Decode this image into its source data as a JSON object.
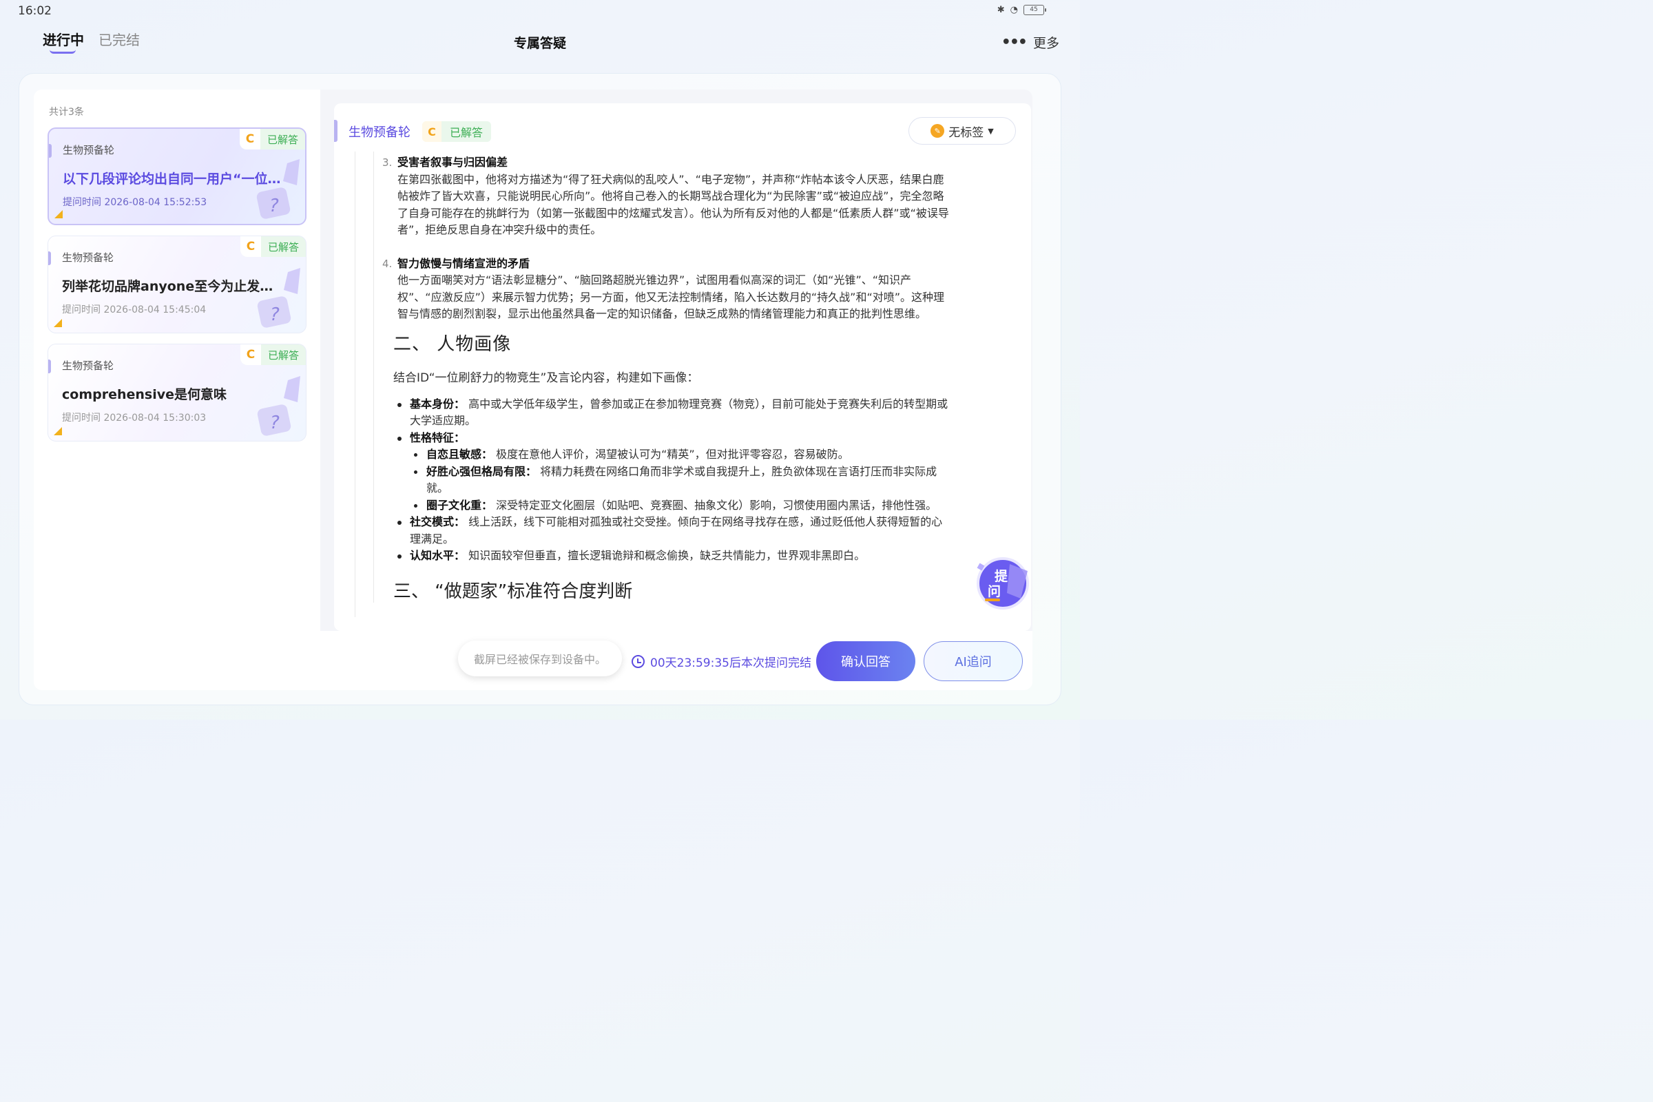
{
  "status_bar": {
    "time": "16:02",
    "battery": "45"
  },
  "nav": {
    "tabs": [
      {
        "label": "进行中"
      },
      {
        "label": "已完结"
      }
    ],
    "title": "专属答疑",
    "more_label": "更多"
  },
  "list": {
    "count": "共计3条",
    "cards": [
      {
        "subject": "生物预备轮",
        "badge_letter": "C",
        "status": "已解答",
        "question": "以下几段评论均出自同一用户“一位…",
        "time": "提问时间 2026-08-04 15:52:53"
      },
      {
        "subject": "生物预备轮",
        "badge_letter": "C",
        "status": "已解答",
        "question": "列举花切品牌anyone至今为止发售…",
        "time": "提问时间 2026-08-04 15:45:04"
      },
      {
        "subject": "生物预备轮",
        "badge_letter": "C",
        "status": "已解答",
        "question": "comprehensive是何意味",
        "time": "提问时间 2026-08-04 15:30:03"
      }
    ]
  },
  "detail": {
    "subject": "生物预备轮",
    "badge_letter": "C",
    "status": "已解答",
    "tag_button": "无标签",
    "items": [
      {
        "num": "3.",
        "title": "受害者叙事与归因偏差",
        "body": "在第四张截图中，他将对方描述为“得了狂犬病似的乱咬人”、“电子宠物”，并声称“炸帖本该令人厌恶，结果白鹿帖被炸了皆大欢喜，只能说明民心所向”。他将自己卷入的长期骂战合理化为“为民除害”或“被迫应战”，完全忽略了自身可能存在的挑衅行为（如第一张截图中的炫耀式发言）。他认为所有反对他的人都是“低素质人群”或“被误导者”，拒绝反思自身在冲突升级中的责任。"
      },
      {
        "num": "4.",
        "title": "智力傲慢与情绪宣泄的矛盾",
        "body": "他一方面嘲笑对方“语法彰显糖分”、“脑回路超脱光锥边界”，试图用看似高深的词汇（如“光锥”、“知识产权”、“应激反应”）来展示智力优势；另一方面，他又无法控制情绪，陷入长达数月的“持久战”和“对喷”。这种理智与情感的剧烈割裂，显示出他虽然具备一定的知识储备，但缺乏成熟的情绪管理能力和真正的批判性思维。"
      }
    ],
    "section2_title": "二、 人物画像",
    "section2_intro": "结合ID“一位刷舒力的物竞生”及言论内容，构建如下画像：",
    "profile": [
      {
        "label": "基本身份：",
        "text": " 高中或大学低年级学生，曾参加或正在参加物理竞赛（物竞），目前可能处于竞赛失利后的转型期或大学适应期。"
      },
      {
        "label": "性格特征：",
        "text": ""
      },
      {
        "label": "社交模式：",
        "text": " 线上活跃，线下可能相对孤独或社交受挫。倾向于在网络寻找存在感，通过贬低他人获得短暂的心理满足。"
      },
      {
        "label": "认知水平：",
        "text": " 知识面较窄但垂直，擅长逻辑诡辩和概念偷换，缺乏共情能力，世界观非黑即白。"
      }
    ],
    "traits": [
      {
        "label": "自恋且敏感：",
        "text": " 极度在意他人评价，渴望被认可为“精英”，但对批评零容忍，容易破防。"
      },
      {
        "label": "好胜心强但格局有限：",
        "text": " 将精力耗费在网络口角而非学术或自我提升上，胜负欲体现在言语打压而非实际成就。"
      },
      {
        "label": "圈子文化重：",
        "text": " 深受特定亚文化圈层（如贴吧、竞赛圈、抽象文化）影响，习惯使用圈内黑话，排他性强。"
      }
    ],
    "section3_title": "三、 “做题家”标准符合度判断"
  },
  "float_ask": {
    "line1": "提",
    "line2": "问"
  },
  "bottom": {
    "toast": "截屏已经被保存到设备中。",
    "countdown": "00天23:59:35后本次提问完结",
    "confirm_button": "确认回答",
    "ai_button": "AI追问"
  }
}
